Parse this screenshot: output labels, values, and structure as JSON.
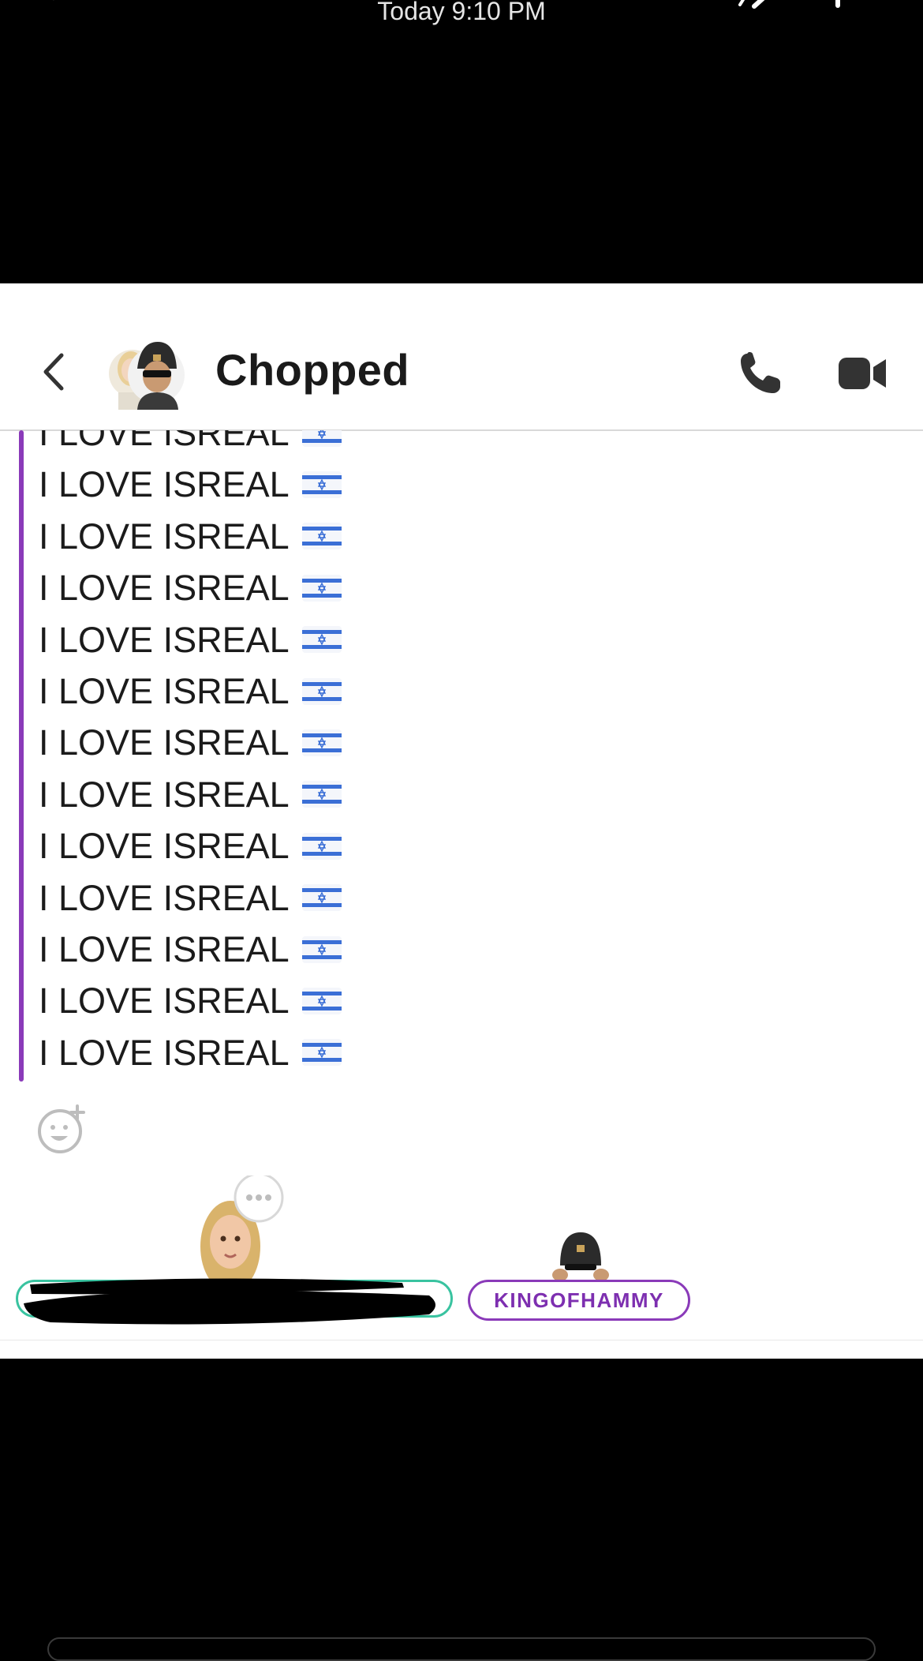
{
  "viewer": {
    "timestamp": "Today 9:10 PM"
  },
  "header": {
    "title": "Chopped",
    "icons": [
      "back-chevron-icon",
      "group-avatar",
      "phone-icon",
      "video-camera-icon"
    ]
  },
  "messages": {
    "accent_color": "#8a3ab9",
    "lines": [
      "I LOVE ISREAL",
      "I LOVE ISREAL",
      "I LOVE ISREAL",
      "I LOVE ISREAL",
      "I LOVE ISREAL",
      "I LOVE ISREAL",
      "I LOVE ISREAL",
      "I LOVE ISREAL",
      "I LOVE ISREAL",
      "I LOVE ISREAL",
      "I LOVE ISREAL",
      "I LOVE ISREAL",
      "I LOVE ISREAL"
    ],
    "line_emoji": "israel-flag-icon"
  },
  "presence": {
    "left_user_color": "#39c3a0",
    "right_user_name": "KINGOFHAMMY",
    "right_user_color": "#8a3ab9"
  }
}
